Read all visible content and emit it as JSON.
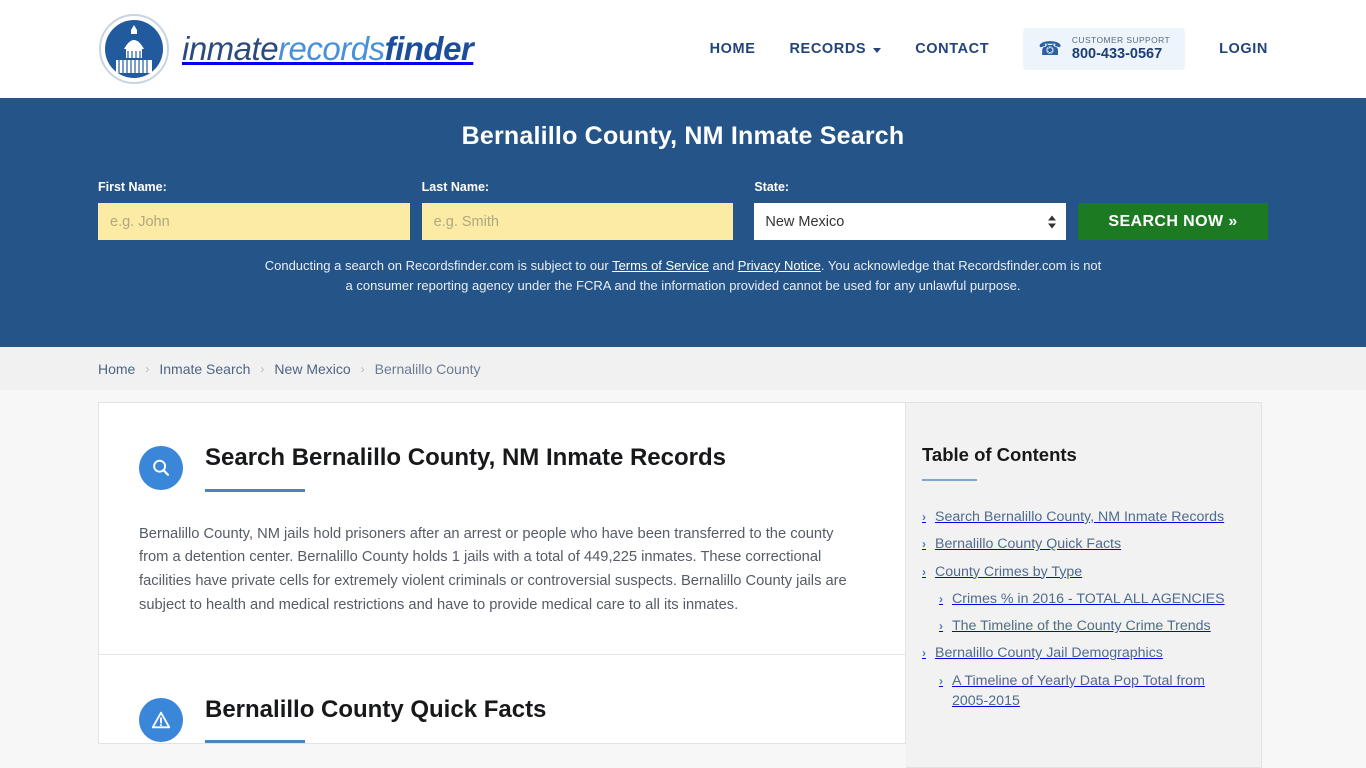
{
  "header": {
    "brand": {
      "part1": "inmate",
      "part2": "records",
      "part3": "finder",
      "logo_icon": "capitol-dome-logo"
    },
    "nav": [
      {
        "label": "HOME",
        "icon": null
      },
      {
        "label": "RECORDS",
        "icon": "chevron-down-icon"
      },
      {
        "label": "CONTACT",
        "icon": null
      }
    ],
    "support": {
      "icon": "headset-icon",
      "caption": "CUSTOMER SUPPORT",
      "phone": "800-433-0567"
    },
    "login_label": "LOGIN"
  },
  "hero": {
    "title": "Bernalillo County, NM Inmate Search",
    "accent_bg": "#255489",
    "first_name": {
      "label": "First Name:",
      "value": "",
      "placeholder": "e.g. John"
    },
    "last_name": {
      "label": "Last Name:",
      "value": "",
      "placeholder": "e.g. Smith"
    },
    "state": {
      "label": "State:",
      "value": "New Mexico",
      "options": [
        "New Mexico"
      ]
    },
    "search_button": {
      "label": "SEARCH NOW »",
      "color": "#1c7a22"
    },
    "disclaimer": {
      "part1": "Conducting a search on Recordsfinder.com is subject to our ",
      "link1": "Terms of Service",
      "part2": " and ",
      "link2": "Privacy Notice",
      "part3": ". You acknowledge that Recordsfinder.com is not a consumer reporting agency under the FCRA and the information provided cannot be used for any unlawful purpose."
    }
  },
  "breadcrumb": {
    "separator": "›",
    "items": [
      {
        "label": "Home",
        "current": false
      },
      {
        "label": "Inmate Search",
        "current": false
      },
      {
        "label": "New Mexico",
        "current": false
      },
      {
        "label": "Bernalillo County",
        "current": true
      }
    ]
  },
  "main": {
    "sections": [
      {
        "icon": "magnifier-icon",
        "title": "Search Bernalillo County, NM Inmate Records",
        "body": "Bernalillo County, NM jails hold prisoners after an arrest or people who have been transferred to the county from a detention center. Bernalillo County holds 1 jails with a total of 449,225 inmates. These correctional facilities have private cells for extremely violent criminals or controversial suspects. Bernalillo County jails are subject to health and medical restrictions and have to provide medical care to all its inmates."
      },
      {
        "icon": "warning-triangle-icon",
        "title": "Bernalillo County Quick Facts",
        "body": ""
      }
    ]
  },
  "sidebar": {
    "title": "Table of Contents",
    "chevron": "›",
    "items": [
      {
        "label": "Search Bernalillo County, NM Inmate Records",
        "level": 1
      },
      {
        "label": "Bernalillo County Quick Facts",
        "level": 1
      },
      {
        "label": "County Crimes by Type",
        "level": 1
      },
      {
        "label": "Crimes % in 2016 - TOTAL ALL AGENCIES",
        "level": 2
      },
      {
        "label": "The Timeline of the County Crime Trends",
        "level": 2
      },
      {
        "label": "Bernalillo County Jail Demographics",
        "level": 1
      },
      {
        "label": "A Timeline of Yearly Data Pop Total from 2005-2015",
        "level": 2
      }
    ]
  }
}
